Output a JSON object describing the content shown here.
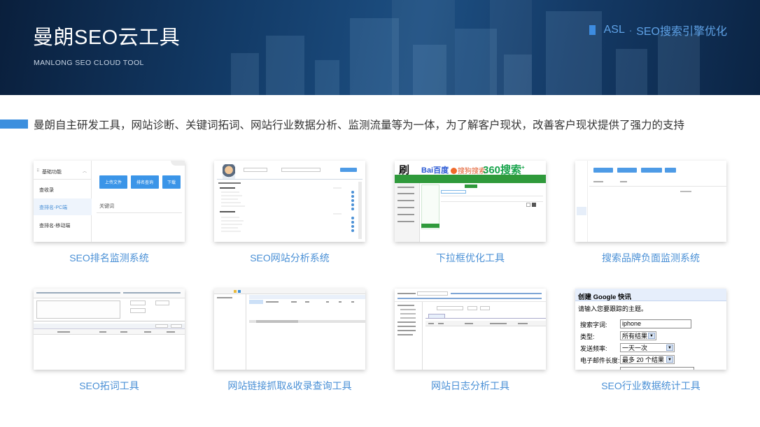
{
  "banner": {
    "title": "曼朗SEO云工具",
    "subtitle": "MANLONG SEO CLOUD TOOL",
    "tag_left": "ASL",
    "tag_sep": "·",
    "tag_right": "SEO搜索引擎优化"
  },
  "intro": "曼朗自主研发工具，网站诊断、关键词拓词、网站行业数据分析、监测流量等为一体，为了解客户现状，改善客户现状提供了强力的支持",
  "cards": [
    {
      "caption": "SEO排名监测系统"
    },
    {
      "caption": "SEO网站分析系统"
    },
    {
      "caption": "下拉框优化工具"
    },
    {
      "caption": "搜索品牌负面监测系统"
    },
    {
      "caption": "SEO拓词工具"
    },
    {
      "caption": "网站链接抓取&收录查询工具"
    },
    {
      "caption": "网站日志分析工具"
    },
    {
      "caption": "SEO行业数据统计工具"
    }
  ],
  "shot1": {
    "menu_title": "基础功能",
    "menu_items": [
      "查收录",
      "查排名-PC端",
      "查排名-移动端"
    ],
    "buttons": [
      "上传文件",
      "排名查询",
      "下载"
    ],
    "field_label": "关键词"
  },
  "shot3": {
    "logo_char": "刷",
    "baidu": "Bai百度",
    "sogou": "搜狗搜索",
    "so360": "360搜索",
    "so360_plus": "+"
  },
  "shot8": {
    "heading_a": "创建",
    "heading_b": "Google 快讯",
    "prompt": "请输入您要跟踪的主题。",
    "rows": [
      {
        "label": "搜索字词:",
        "value": "iphone"
      },
      {
        "label": "类型:",
        "value": "所有结果"
      },
      {
        "label": "发送频率:",
        "value": "一天一次"
      },
      {
        "label": "电子邮件长度:",
        "value": "最多 20 个结果"
      }
    ]
  },
  "colors": {
    "accent": "#3c8fde",
    "caption": "#4a90d6",
    "banner_dark": "#0a1f3c",
    "intro_text": "#333333"
  }
}
